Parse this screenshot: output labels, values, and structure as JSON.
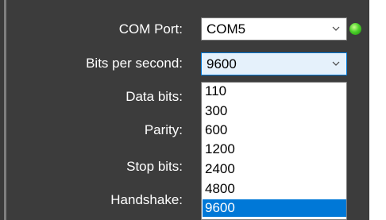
{
  "form": {
    "com_port_label": "COM Port:",
    "bits_label": "Bits per second:",
    "data_bits_label": "Data bits:",
    "parity_label": "Parity:",
    "stop_bits_label": "Stop bits:",
    "handshake_label": "Handshake:"
  },
  "com_port": {
    "value": "COM5",
    "status_color": "#4cd12a"
  },
  "baud": {
    "value": "9600",
    "options": [
      "110",
      "300",
      "600",
      "1200",
      "2400",
      "4800",
      "9600"
    ],
    "selected": "9600"
  },
  "colors": {
    "accent": "#0078d7",
    "background": "#3c3c3c"
  }
}
